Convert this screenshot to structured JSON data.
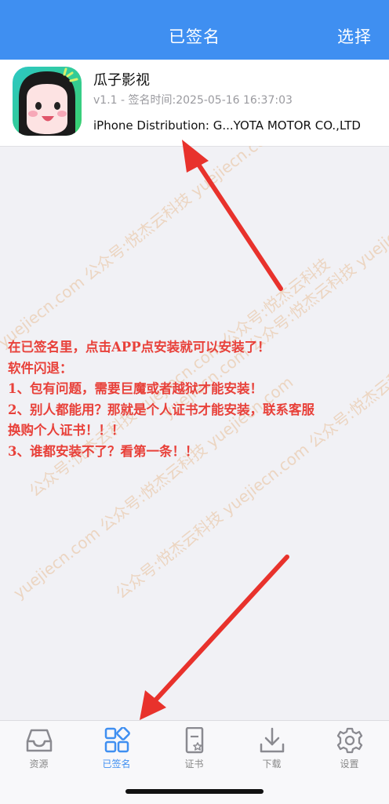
{
  "navbar": {
    "title": "已签名",
    "action": "选择"
  },
  "app": {
    "name": "瓜子影视",
    "meta": "v1.1 - 签名时间:2025-05-16 16:37:03",
    "certificate": "iPhone Distribution: G...YOTA MOTOR CO.,LTD"
  },
  "watermark": {
    "lines": [
      "yuejiecn.com  公众号:悦杰云科技  yuejiecn.com",
      "公众号:悦杰云科技  yuejiecn.com  公众号:悦杰云科技",
      "yuejiecn.com  公众号:悦杰云科技  yuejiecn.com",
      "公众号:悦杰云科技  yuejiecn.com  公众号:悦杰云科技",
      "yuejiecn.com  公众号:悦杰云科技  yuejiecn.com"
    ]
  },
  "notice": {
    "lines": [
      "在已签名里，点击APP点安装就可以安装了！",
      "软件闪退：",
      "1、包有问题，需要巨魔或者越狱才能安装！",
      "2、别人都能用？那就是个人证书才能安装，联系客服",
      "换购个人证书！！！",
      "3、谁都安装不了？看第一条！！"
    ]
  },
  "tabs": [
    {
      "label": "资源",
      "icon": "inbox-tray-icon",
      "active": false
    },
    {
      "label": "已签名",
      "icon": "grid-apps-icon",
      "active": true
    },
    {
      "label": "证书",
      "icon": "certificate-icon",
      "active": false
    },
    {
      "label": "下载",
      "icon": "download-icon",
      "active": false
    },
    {
      "label": "设置",
      "icon": "gear-icon",
      "active": false
    }
  ],
  "colors": {
    "accent": "#3f8ff1",
    "notice_red": "#e8413a",
    "arrow_red": "#e8322c",
    "tab_inactive": "#888888"
  }
}
